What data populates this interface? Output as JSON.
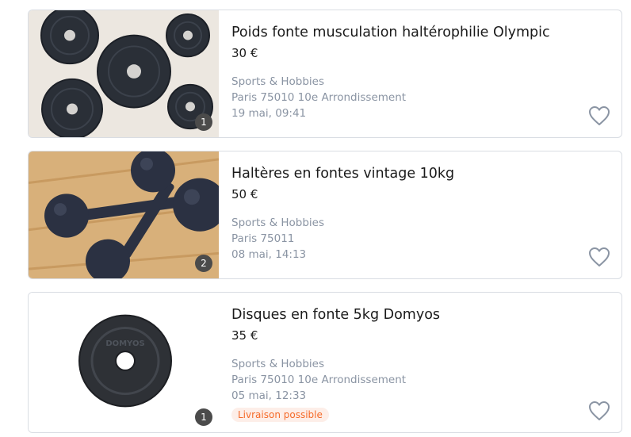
{
  "listings": [
    {
      "title": "Poids fonte musculation haltérophilie Olympic",
      "price": "30 €",
      "category": "Sports & Hobbies",
      "location": "Paris 75010 10e Arrondissement",
      "date": "19 mai, 09:41",
      "photo_count": "1",
      "favorite_icon": "heart-outline-icon"
    },
    {
      "title": "Haltères en fontes vintage 10kg",
      "price": "50 €",
      "category": "Sports & Hobbies",
      "location": "Paris 75011",
      "date": "08 mai, 14:13",
      "photo_count": "2",
      "favorite_icon": "heart-outline-icon"
    },
    {
      "title": "Disques en fonte 5kg Domyos",
      "price": "35 €",
      "category": "Sports & Hobbies",
      "location": "Paris 75010 10e Arrondissement",
      "date": "05 mai, 12:33",
      "photo_count": "1",
      "delivery_tag": "Livraison possible",
      "favorite_icon": "heart-outline-icon"
    }
  ],
  "image_disc_text": "DOMYOS",
  "colors": {
    "accent": "#f56b2a",
    "meta_text": "#8a94a3",
    "border": "#d9dde3"
  }
}
